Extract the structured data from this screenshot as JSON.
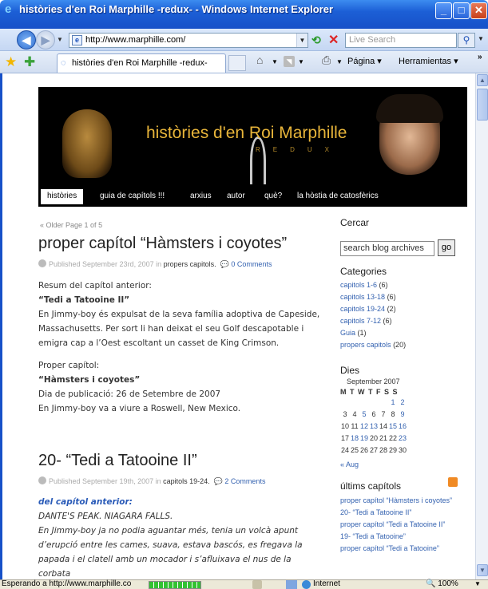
{
  "window": {
    "title": "històries d'en Roi Marphille -redux- - Windows Internet Explorer",
    "min_icon": "minimize-icon",
    "max_icon": "maximize-icon",
    "close_icon": "close-icon"
  },
  "address": {
    "url": "http://www.marphille.com/",
    "search_placeholder": "Live Search"
  },
  "tabs": {
    "active_label": "històries d'en Roi Marphille -redux-"
  },
  "commands": {
    "page_label": "Página ▾",
    "tools_label": "Herramientas ▾"
  },
  "header": {
    "title": "històries d'en Roi Marphille",
    "subtitle": "REDUX",
    "nav": [
      "històries",
      "guia de capítols !!!",
      "arxius",
      "autor",
      "què?",
      "la hòstia de catosfèrics"
    ]
  },
  "pagination": {
    "older": "« Older",
    "page": "Page 1 of 5"
  },
  "posts": [
    {
      "title": "proper capítol “Hàmsters i coyotes”",
      "published": "Published September 23rd, 2007 in",
      "category": "propers capitols.",
      "comments": "0 Comments",
      "lines": [
        "Resum del capítol anterior:",
        "“Tedi a Tatooine II”",
        "En Jimmy-boy és expulsat de la seva família adoptiva de Capeside,",
        "Massachusetts. Per sort li han deixat el seu Golf descapotable i",
        "emigra cap a l’Oest escoltant un casset de King Crimson.",
        "Proper capítol:",
        "“Hàmsters i coyotes”",
        "Dia de publicació: 26 de Setembre de 2007",
        "En Jimmy-boy va a viure a Roswell, New Mexico."
      ]
    },
    {
      "title": "20- “Tedi a Tatooine II”",
      "published": "Published September 19th, 2007 in",
      "category": "capitols 19-24.",
      "comments": "2 Comments",
      "lines": [
        "del capítol anterior:",
        "DANTE'S PEAK. NIAGARA FALLS.",
        "En Jimmy-boy ja no podia aguantar més, tenia un volcà apunt",
        "d’erupció entre les cames, suava, estava bascós, es fregava la",
        "papada i el clatell amb un mocador i s’afluixava el nus de la",
        "corbata"
      ]
    }
  ],
  "sidebar": {
    "search_heading": "Cercar",
    "search_value": "search blog archives",
    "search_button": "go",
    "categories_heading": "Categories",
    "categories": [
      {
        "name": "capitols 1-6",
        "count": "(6)"
      },
      {
        "name": "capitols 13-18",
        "count": "(6)"
      },
      {
        "name": "capitols 19-24",
        "count": "(2)"
      },
      {
        "name": "capitols 7-12",
        "count": "(6)"
      },
      {
        "name": "Guia",
        "count": "(1)"
      },
      {
        "name": "propers capitols",
        "count": "(20)"
      }
    ],
    "days_heading": "Dies",
    "calendar_caption": "September 2007",
    "calendar_days": "M T W T F S S",
    "calendar_rows": [
      [
        "",
        "",
        "",
        "",
        "",
        "1",
        "2"
      ],
      [
        "3",
        "4",
        "5",
        "6",
        "7",
        "8",
        "9"
      ],
      [
        "10",
        "11",
        "12",
        "13",
        "14",
        "15",
        "16"
      ],
      [
        "17",
        "18",
        "19",
        "20",
        "21",
        "22",
        "23"
      ],
      [
        "24",
        "25",
        "26",
        "27",
        "28",
        "29",
        "30"
      ]
    ],
    "calendar_linked": [
      "1",
      "2",
      "5",
      "9",
      "12",
      "13",
      "15",
      "16",
      "18",
      "19",
      "23"
    ],
    "calendar_prev": "« Aug",
    "latest_heading": "últims capítols",
    "latest": [
      "proper capítol “Hàmsters i coyotes”",
      "20- “Tedi a Tatooine II”",
      "proper capítol “Tedi a Tatooine II”",
      "19- “Tedi a Tatooine”",
      "proper capítol “Tedi a Tatooine”"
    ]
  },
  "status": {
    "text": "Esperando a http://www.marphille.co",
    "zone": "Internet",
    "zoom": "🔍 100%"
  },
  "colors": {
    "title_bar": "#1c5fd6",
    "link": "#3462b0",
    "header_title": "#e8b53a"
  }
}
